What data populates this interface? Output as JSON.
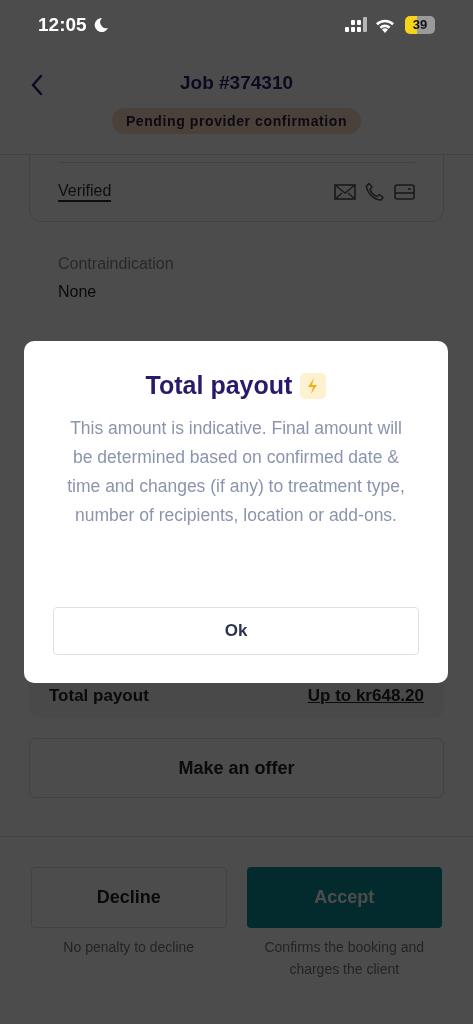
{
  "status_bar": {
    "time": "12:05",
    "battery": "39"
  },
  "header": {
    "title": "Job #374310",
    "status_badge": "Pending provider confirmation"
  },
  "client_card": {
    "verification": "Verified"
  },
  "contraindication": {
    "label": "Contraindication",
    "value": "None"
  },
  "payout": {
    "label": "Total payout",
    "value": "Up to kr648.20"
  },
  "offer_button": "Make an offer",
  "actions": [
    {
      "label": "Decline",
      "kind": "secondary",
      "caption": "No penalty to decline"
    },
    {
      "label": "Accept",
      "kind": "primary",
      "caption": "Confirms the booking and charges the client"
    }
  ],
  "dialog": {
    "title": "Total payout",
    "message": "This amount is indicative. Final amount will be determined based on confirmed date & time and changes (if any) to treatment type, number of recipients, location or add-ons.",
    "button": "Ok"
  }
}
